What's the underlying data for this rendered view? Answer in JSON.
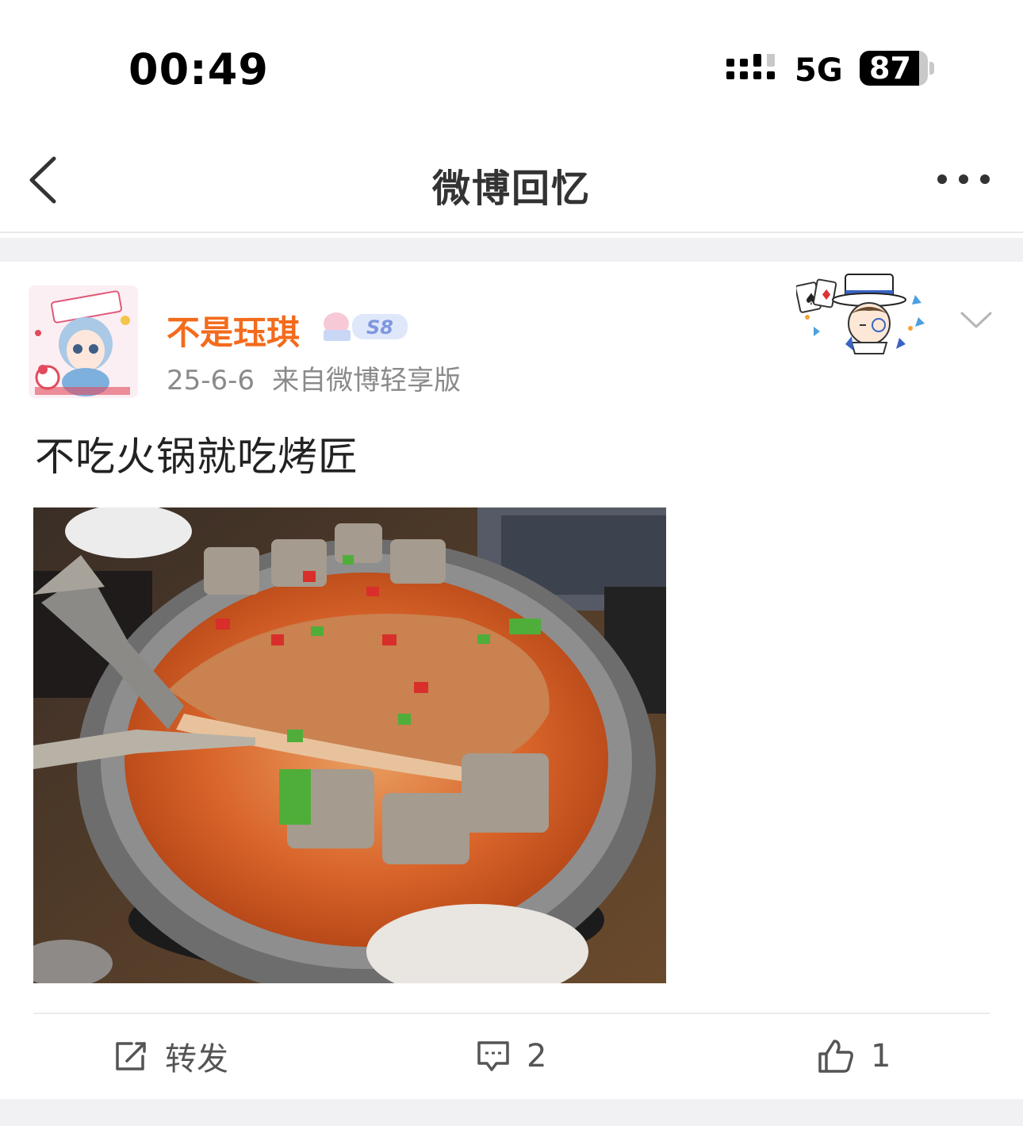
{
  "status_bar": {
    "time": "00:49",
    "network": "5G",
    "battery_level": "87",
    "battery_fraction": 0.87
  },
  "nav": {
    "title": "微博回忆",
    "back_icon": "chevron-left-icon",
    "more_icon": "more-icon"
  },
  "post": {
    "username": "不是珏琪",
    "username_color": "#f36b1c",
    "level_badge": "S8",
    "date": "25-6-6",
    "source": "来自微博轻享版",
    "text": "不吃火锅就吃烤匠",
    "actions": {
      "repost_label": "转发",
      "comment_count": "2",
      "like_count": "1"
    }
  }
}
